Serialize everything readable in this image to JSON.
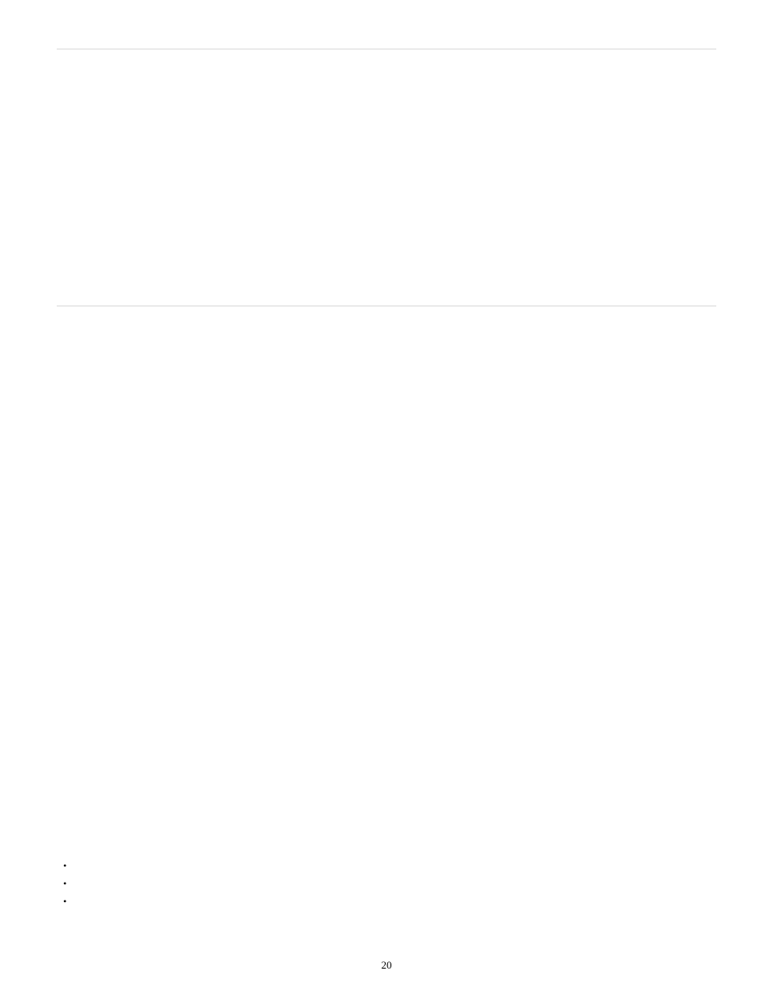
{
  "page": {
    "number": "20"
  },
  "bullets": {
    "items": [
      "",
      "",
      ""
    ]
  }
}
